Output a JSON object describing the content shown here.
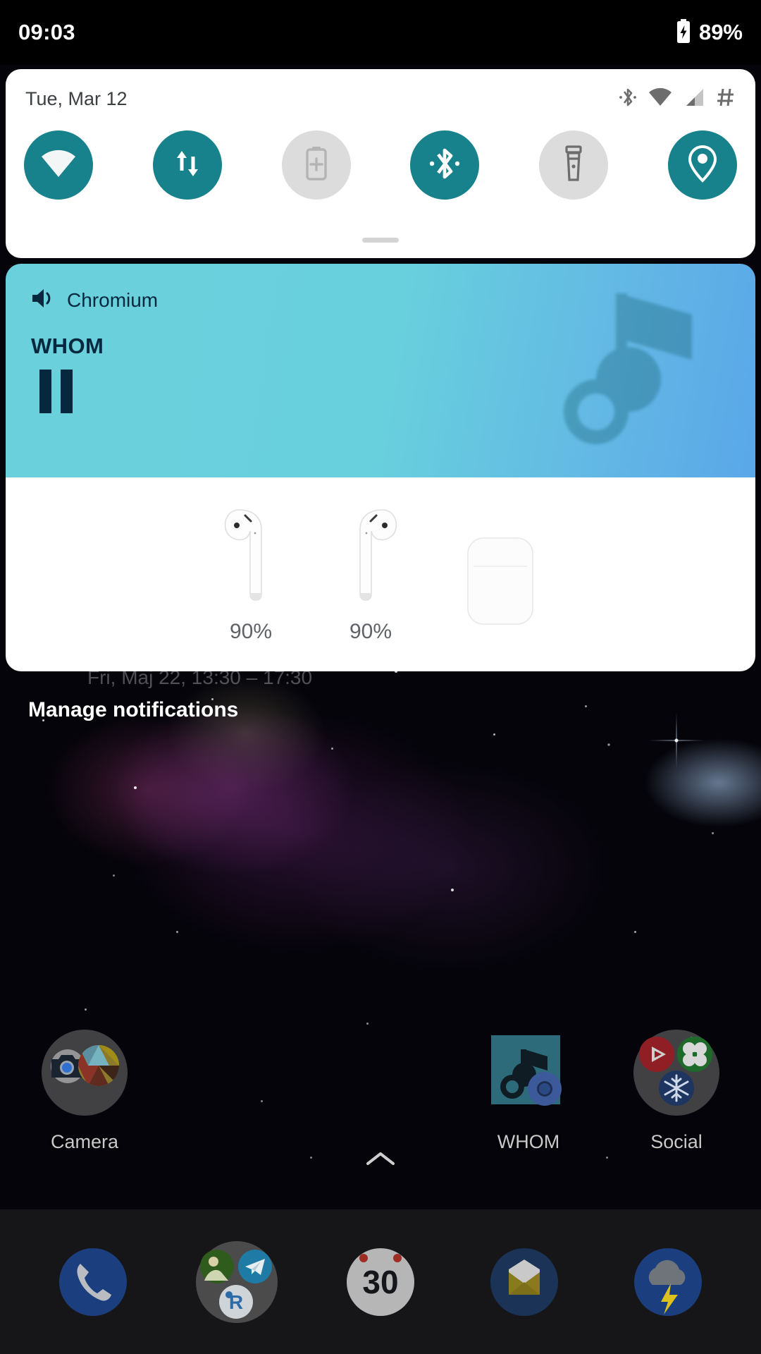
{
  "status_bar": {
    "time": "09:03",
    "battery_percent": "89%",
    "battery_icon": "battery-charging-icon"
  },
  "quick_settings": {
    "date": "Tue, Mar 12",
    "status_icons": [
      {
        "name": "bluetooth-icon"
      },
      {
        "name": "wifi-icon"
      },
      {
        "name": "cellular-signal-icon"
      },
      {
        "name": "hash-icon"
      }
    ],
    "accent_on_color": "#17818c",
    "off_color": "#dcdcdc",
    "tiles": [
      {
        "name": "wifi-tile",
        "icon": "wifi-icon",
        "state": "on"
      },
      {
        "name": "mobile-data-tile",
        "icon": "data-transfer-icon",
        "state": "on"
      },
      {
        "name": "battery-saver-tile",
        "icon": "battery-plus-icon",
        "state": "off"
      },
      {
        "name": "bluetooth-tile",
        "icon": "bluetooth-icon",
        "state": "on"
      },
      {
        "name": "flashlight-tile",
        "icon": "flashlight-icon",
        "state": "off"
      },
      {
        "name": "location-tile",
        "icon": "location-pin-icon",
        "state": "on"
      }
    ]
  },
  "media_notification": {
    "app_name": "Chromium",
    "app_icon": "volume-speaker-icon",
    "title": "WHOM",
    "transport_button": "pause-button",
    "artwork_icon": "music-note-icon",
    "background_start": "#6ad0dc",
    "background_end": "#5aa7e8",
    "foreground_color": "#06283f"
  },
  "earbuds_notification": {
    "devices": [
      {
        "name": "left-earbud",
        "battery": "90%"
      },
      {
        "name": "right-earbud",
        "battery": "90%"
      },
      {
        "name": "charging-case",
        "battery": ""
      }
    ]
  },
  "shade_footer": {
    "manage_label": "Manage notifications"
  },
  "obscured_widget": {
    "text": "Fri, Maj 22, 13:30 – 17:30"
  },
  "home_screen": {
    "apps": [
      {
        "name": "camera-folder",
        "label": "Camera"
      },
      {
        "name": "whom-app",
        "label": "WHOM"
      },
      {
        "name": "social-folder",
        "label": "Social"
      }
    ],
    "page_up_arrow": "chevron-up-icon"
  },
  "dock": {
    "items": [
      {
        "name": "phone-app",
        "icon": "phone-icon"
      },
      {
        "name": "messaging-folder",
        "icon": "folder-icon"
      },
      {
        "name": "clock-app",
        "icon": "clock-icon",
        "badge": "30"
      },
      {
        "name": "email-app",
        "icon": "envelope-icon"
      },
      {
        "name": "weather-app",
        "icon": "storm-cloud-icon"
      }
    ]
  }
}
